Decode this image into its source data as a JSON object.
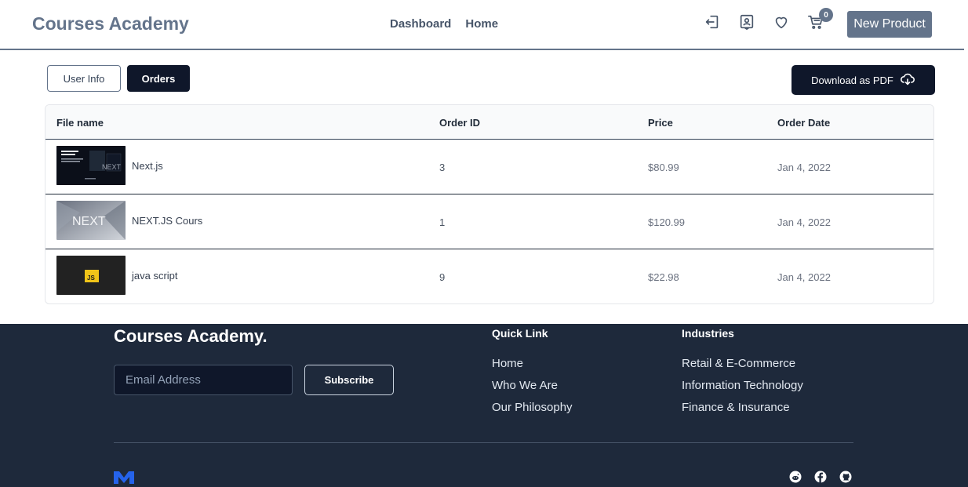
{
  "header": {
    "brand": "Courses Academy",
    "nav": [
      "Dashboard",
      "Home"
    ],
    "cart_count": "0",
    "new_product_label": "New Product"
  },
  "tabs": {
    "user_info": "User Info",
    "orders": "Orders"
  },
  "download_label": "Download as PDF",
  "table": {
    "columns": [
      "File name",
      "Order ID",
      "Price",
      "Order Date"
    ],
    "rows": [
      {
        "name": "Next.js",
        "order_id": "3",
        "price": "$80.99",
        "date": "Jan 4, 2022"
      },
      {
        "name": "NEXT.JS Cours",
        "order_id": "1",
        "price": "$120.99",
        "date": "Jan 4, 2022"
      },
      {
        "name": "java script",
        "order_id": "9",
        "price": "$22.98",
        "date": "Jan 4, 2022"
      }
    ]
  },
  "footer": {
    "brand": "Courses Academy.",
    "email_placeholder": "Email Address",
    "subscribe_label": "Subscribe",
    "quick_link": {
      "title": "Quick Link",
      "links": [
        "Home",
        "Who We Are",
        "Our Philosophy"
      ]
    },
    "industries": {
      "title": "Industries",
      "links": [
        "Retail & E-Commerce",
        "Information Technology",
        "Finance & Insurance"
      ]
    },
    "logo_text": "",
    "social_icons": [
      "reddit-icon",
      "facebook-icon",
      "github-icon"
    ]
  },
  "colors": {
    "primary_dark": "#0f172a",
    "slate": "#64748b",
    "footer_bg": "#1e293b",
    "js_yellow": "#f0c419"
  }
}
